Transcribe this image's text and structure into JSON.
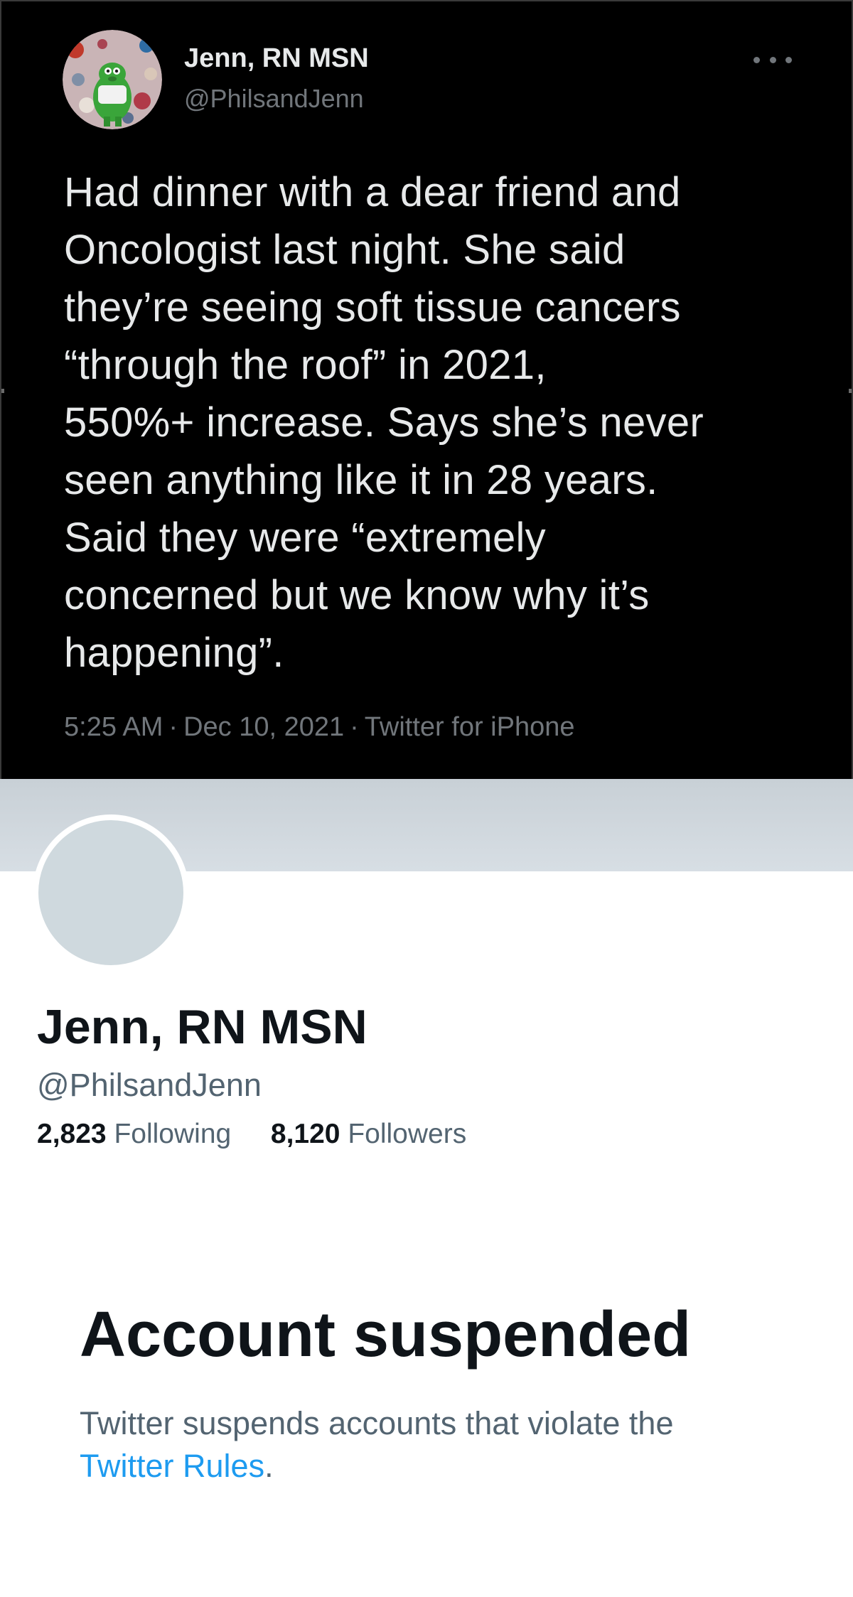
{
  "tweet": {
    "author_name": "Jenn, RN MSN",
    "author_handle": "@PhilsandJenn",
    "more_icon": "more-horizontal-icon",
    "body_lines": [
      "Had dinner with a dear friend and",
      "Oncologist last night.  She said",
      "they’re seeing soft tissue cancers",
      "“through the roof” in  2021,",
      "550%+ increase. Says she’s never",
      "seen anything like it in 28 years.",
      "Said they were “extremely",
      "concerned but we know why it’s",
      "happening”."
    ],
    "time": "5:25 AM",
    "separator": "·",
    "date": "Dec 10, 2021",
    "source": "Twitter for iPhone"
  },
  "profile": {
    "name": "Jenn, RN MSN",
    "handle": "@PhilsandJenn",
    "following_count": "2,823",
    "following_label": "Following",
    "followers_count": "8,120",
    "followers_label": "Followers"
  },
  "suspension": {
    "title": "Account suspended",
    "message": "Twitter suspends accounts that violate the",
    "link_text": "Twitter Rules",
    "period": "."
  },
  "colors": {
    "tweet_background": "#000000",
    "link": "#1d9bf0",
    "secondary_text": "#536471",
    "avatar_placeholder": "#cfd9de",
    "banner": "#d0d8de"
  }
}
